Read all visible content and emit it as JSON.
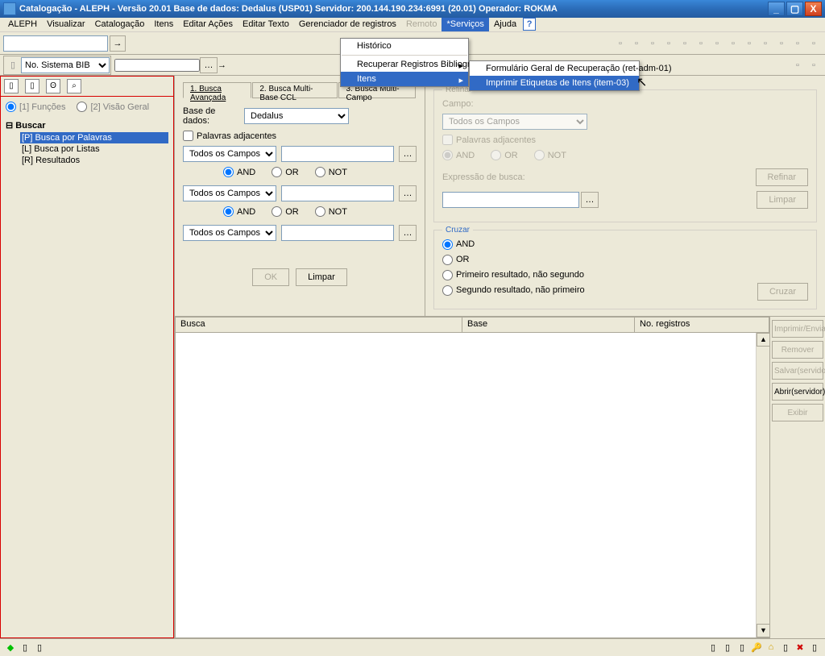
{
  "window": {
    "title": "Catalogação - ALEPH - Versão 20.01 Base de dados: Dedalus (USP01) Servidor: 200.144.190.234:6991 (20.01) Operador: ROKMA"
  },
  "menubar": {
    "items": [
      "ALEPH",
      "Visualizar",
      "Catalogação",
      "Itens",
      "Editar Ações",
      "Editar Texto",
      "Gerenciador de registros",
      "Remoto",
      "*Serviços",
      "Ajuda"
    ]
  },
  "services_menu": {
    "items": [
      "Histórico",
      "Recuperar Registros Bibliográficos",
      "Itens"
    ]
  },
  "itens_submenu": {
    "items": [
      "Formulário Geral de Recuperação (ret-adm-01)",
      "Imprimir Etiquetas de Itens (item-03)"
    ]
  },
  "toolbar2": {
    "system_label": "No. Sistema BIB"
  },
  "left_panel": {
    "radio1": "[1] Funções",
    "radio2": "[2] Visão Geral",
    "tree_root": "Buscar",
    "tree_items": [
      "[P] Busca por Palavras",
      "[L] Busca por Listas",
      "[R] Resultados"
    ]
  },
  "search": {
    "tabs": [
      "1. Busca Avançada",
      "2. Busca Multi-Base CCL",
      "3. Busca Multi-Campo"
    ],
    "base_label": "Base de dados:",
    "base_value": "Dedalus",
    "adjacent_label": "Palavras adjacentes",
    "field_option": "Todos os Campos",
    "op_and": "AND",
    "op_or": "OR",
    "op_not": "NOT",
    "ok_btn": "OK",
    "clear_btn": "Limpar"
  },
  "refine": {
    "title": "Refinar",
    "campo_label": "Campo:",
    "campo_value": "Todos os Campos",
    "adjacent": "Palavras adjacentes",
    "expr_label": "Expressão de busca:",
    "refine_btn": "Refinar",
    "clear_btn": "Limpar"
  },
  "cross": {
    "title": "Cruzar",
    "opt1": "AND",
    "opt2": "OR",
    "opt3": "Primeiro resultado, não segundo",
    "opt4": "Segundo resultado, não primeiro",
    "btn": "Cruzar"
  },
  "results": {
    "col1": "Busca",
    "col2": "Base",
    "col3": "No. registros"
  },
  "side_buttons": {
    "b1": "Imprimir/Enviar",
    "b2": "Remover",
    "b3": "Salvar(servidor)",
    "b4": "Abrir(servidor)",
    "b5": "Exibir"
  }
}
